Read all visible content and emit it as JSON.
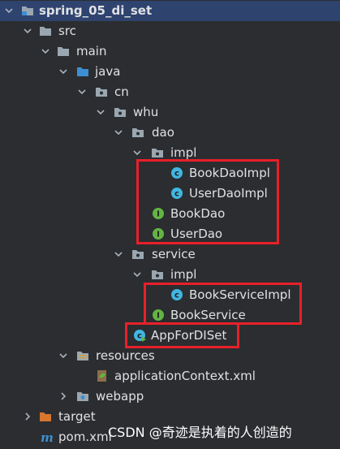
{
  "tree": {
    "project": "spring_05_di_set",
    "src": "src",
    "main": "main",
    "java": "java",
    "cn": "cn",
    "whu": "whu",
    "dao": "dao",
    "dao_impl": "impl",
    "book_dao_impl": "BookDaoImpl",
    "user_dao_impl": "UserDaoImpl",
    "book_dao": "BookDao",
    "user_dao": "UserDao",
    "service": "service",
    "service_impl": "impl",
    "book_service_impl": "BookServiceImpl",
    "book_service": "BookService",
    "app": "AppForDISet",
    "resources": "resources",
    "app_context": "applicationContext.xml",
    "webapp": "webapp",
    "target": "target",
    "pom": "pom.xml"
  },
  "watermark": "CSDN @奇迹是执着的人创造的",
  "colors": {
    "background": "#2b2d30",
    "folder": "#9aa7b0",
    "source_folder": "#3d8fd1",
    "class_icon": "#40b6e0",
    "interface_icon": "#62b543",
    "highlight": "#e8202a",
    "target_folder": "#d7762c"
  }
}
